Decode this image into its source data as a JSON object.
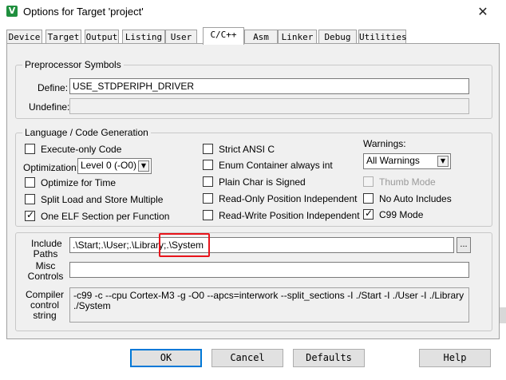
{
  "window": {
    "title": "Options for Target 'project'",
    "icon": "keil-uvision-icon",
    "icon_letter": "V",
    "close_glyph": "✕"
  },
  "tabs": [
    {
      "label": "Device",
      "active": false
    },
    {
      "label": "Target",
      "active": false
    },
    {
      "label": "Output",
      "active": false
    },
    {
      "label": "Listing",
      "active": false
    },
    {
      "label": "User",
      "active": false
    },
    {
      "label": "C/C++",
      "active": true
    },
    {
      "label": "Asm",
      "active": false
    },
    {
      "label": "Linker",
      "active": false
    },
    {
      "label": "Debug",
      "active": false
    },
    {
      "label": "Utilities",
      "active": false
    }
  ],
  "preprocessor": {
    "title": "Preprocessor Symbols",
    "define_label": "Define:",
    "define_value": "USE_STDPERIPH_DRIVER",
    "undefine_label": "Undefine:",
    "undefine_value": ""
  },
  "language": {
    "title": "Language / Code Generation",
    "execute_only": {
      "label": "Execute-only Code",
      "checked": false
    },
    "optimization_label": "Optimization:",
    "optimization_value": "Level 0 (-O0)",
    "optimize_time": {
      "label": "Optimize for Time",
      "checked": false
    },
    "split_load": {
      "label": "Split Load and Store Multiple",
      "checked": false
    },
    "one_elf": {
      "label": "One ELF Section per Function",
      "checked": true
    },
    "strict_ansi": {
      "label": "Strict ANSI C",
      "checked": false
    },
    "enum_container": {
      "label": "Enum Container always int",
      "checked": false
    },
    "plain_char": {
      "label": "Plain Char is Signed",
      "checked": false
    },
    "ro_position": {
      "label": "Read-Only Position Independent",
      "checked": false
    },
    "rw_position": {
      "label": "Read-Write Position Independent",
      "checked": false
    },
    "warnings_label": "Warnings:",
    "warnings_value": "All Warnings",
    "thumb_mode": {
      "label": "Thumb Mode",
      "checked": false,
      "disabled": true
    },
    "no_auto_includes": {
      "label": "No Auto Includes",
      "checked": false
    },
    "c99_mode": {
      "label": "C99 Mode",
      "checked": true
    }
  },
  "include_paths": {
    "label_line1": "Include",
    "label_line2": "Paths",
    "value_prefix": ".\\Start;.\\User;.\\Library;",
    "value_highlighted": ".\\System",
    "browse_label": "...",
    "highlight_color": "#e8141b"
  },
  "misc_controls": {
    "label_line1": "Misc",
    "label_line2": "Controls",
    "value": ""
  },
  "compiler_control": {
    "label_line1": "Compiler",
    "label_line2": "control",
    "label_line3": "string",
    "line1": "-c99 -c --cpu Cortex-M3 -g -O0 --apcs=interwork --split_sections -I ./Start -I ./User -I ./Library -I",
    "line2": "./System"
  },
  "buttons": {
    "ok": "OK",
    "cancel": "Cancel",
    "defaults": "Defaults",
    "help": "Help"
  },
  "colors": {
    "accent": "#0078d7",
    "panel_bg": "#f0f0f0"
  }
}
